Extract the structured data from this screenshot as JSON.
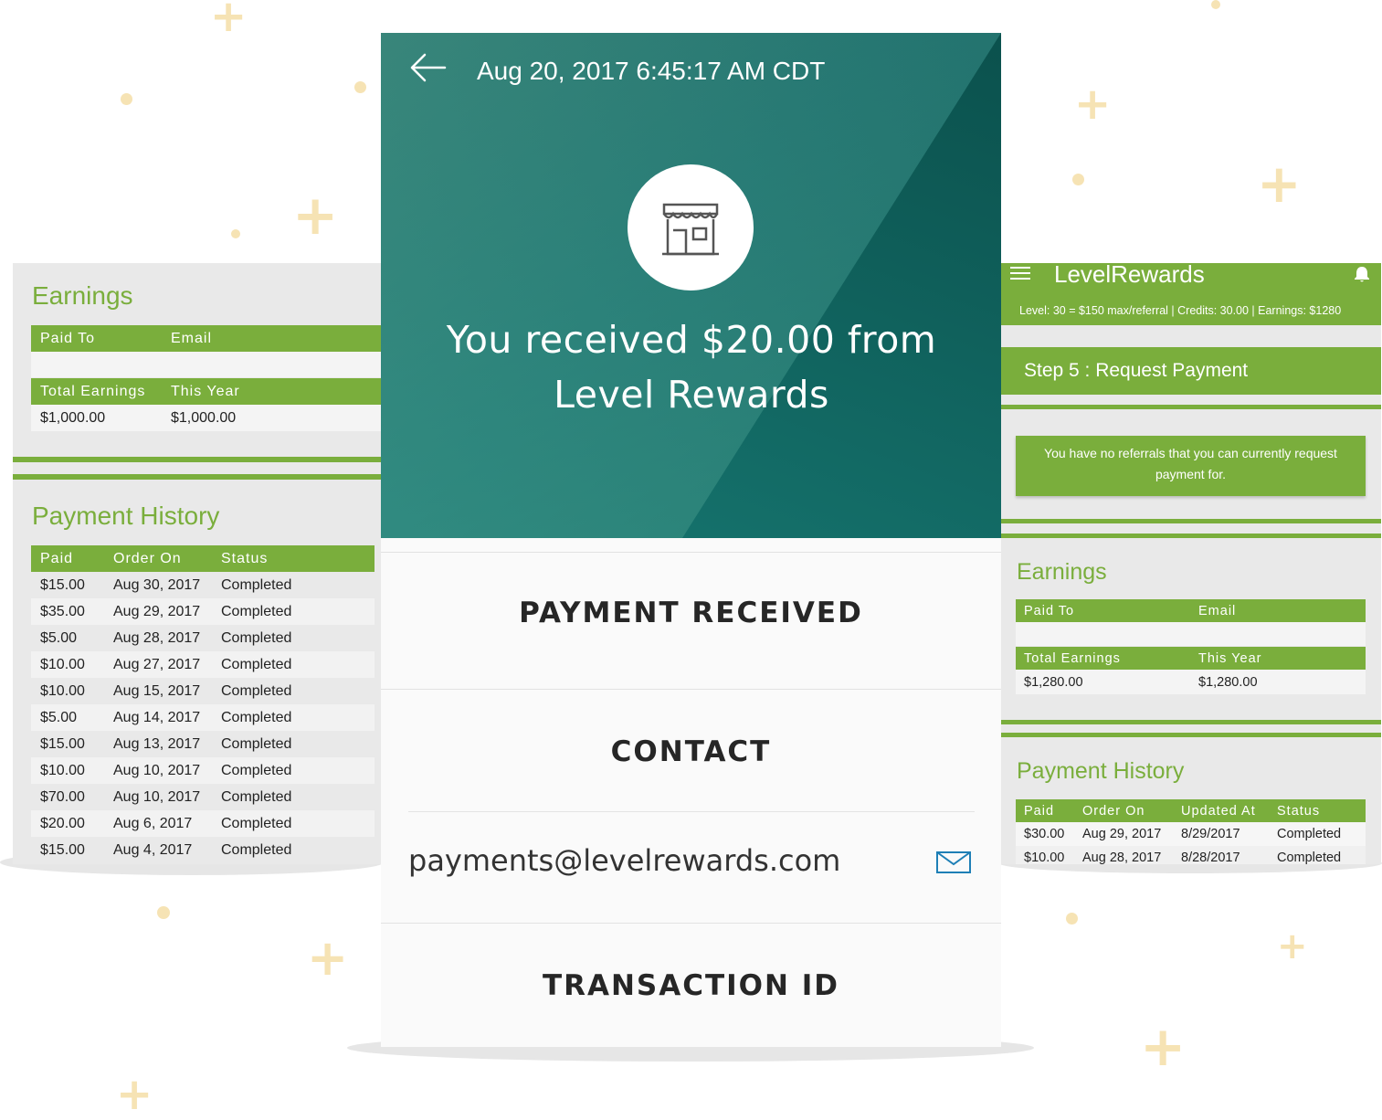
{
  "left_panel": {
    "earnings": {
      "title": "Earnings",
      "headers": [
        "Paid To",
        "Email"
      ],
      "totals_headers": [
        "Total Earnings",
        "This Year"
      ],
      "totals": [
        "$1,000.00",
        "$1,000.00"
      ]
    },
    "payment_history": {
      "title": "Payment History",
      "headers": [
        "Paid",
        "Order On",
        "Status"
      ],
      "rows": [
        [
          "$15.00",
          "Aug 30, 2017",
          "Completed"
        ],
        [
          "$35.00",
          "Aug 29, 2017",
          "Completed"
        ],
        [
          "$5.00",
          "Aug 28, 2017",
          "Completed"
        ],
        [
          "$10.00",
          "Aug 27, 2017",
          "Completed"
        ],
        [
          "$10.00",
          "Aug 15, 2017",
          "Completed"
        ],
        [
          "$5.00",
          "Aug 14, 2017",
          "Completed"
        ],
        [
          "$15.00",
          "Aug 13, 2017",
          "Completed"
        ],
        [
          "$10.00",
          "Aug 10, 2017",
          "Completed"
        ],
        [
          "$70.00",
          "Aug 10, 2017",
          "Completed"
        ],
        [
          "$20.00",
          "Aug 6, 2017",
          "Completed"
        ],
        [
          "$15.00",
          "Aug 4, 2017",
          "Completed"
        ]
      ]
    }
  },
  "center_panel": {
    "date": "Aug 20, 2017",
    "time": "6:45:17 AM CDT",
    "message_line1": "You received $20.00 from",
    "message_line2": "Level Rewards",
    "payment_received_label": "PAYMENT RECEIVED",
    "contact_label": "CONTACT",
    "contact_email": "payments@levelrewards.com",
    "transaction_id_label": "TRANSACTION ID"
  },
  "right_panel": {
    "brand": "LevelRewards",
    "level_info": "Level: 30 = $150 max/referral | Credits: 30.00 | Earnings: $1280",
    "step": "Step 5 : Request Payment",
    "notice": "You have no referrals that you can currently request payment for.",
    "earnings": {
      "title": "Earnings",
      "headers": [
        "Paid To",
        "Email"
      ],
      "totals_headers": [
        "Total Earnings",
        "This Year"
      ],
      "totals": [
        "$1,280.00",
        "$1,280.00"
      ]
    },
    "payment_history": {
      "title": "Payment History",
      "headers": [
        "Paid",
        "Order On",
        "Updated At",
        "Status"
      ],
      "rows": [
        [
          "$30.00",
          "Aug 29, 2017",
          "8/29/2017",
          "Completed"
        ],
        [
          "$10.00",
          "Aug 28, 2017",
          "8/28/2017",
          "Completed"
        ]
      ]
    }
  },
  "colors": {
    "accent_green": "#7aae3c",
    "teal": "#1a6f6a",
    "decor": "#f6e3b4"
  }
}
